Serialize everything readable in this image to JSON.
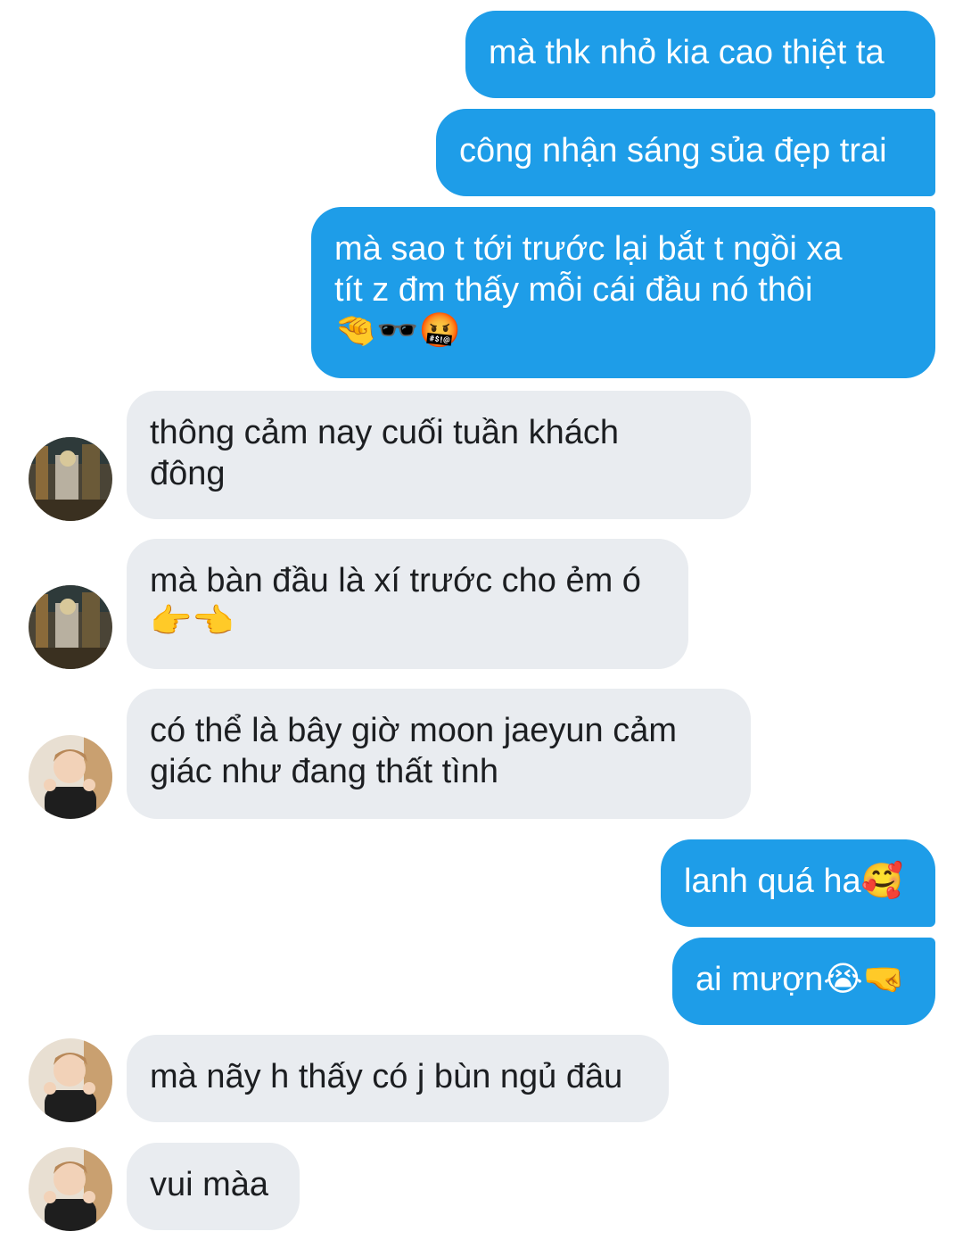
{
  "messages": [
    {
      "side": "out",
      "text": "mà thk nhỏ kia cao thiệt ta"
    },
    {
      "side": "out",
      "text": "công nhận sáng sủa đẹp trai"
    },
    {
      "side": "out",
      "text": "mà sao t tới trước lại bắt t ngồi xa\ntít z đm thấy mỗi cái đầu nó thôi\n🤏🕶️🤬"
    },
    {
      "side": "in",
      "avatar": "avatar-street",
      "text": "thông cảm nay cuối tuần khách\nđông"
    },
    {
      "side": "in",
      "avatar": "avatar-street",
      "text": "mà bàn đầu là xí trước cho ẻm ó\n👉👈"
    },
    {
      "side": "in",
      "avatar": "avatar-person",
      "text": "có thể là bây giờ moon jaeyun cảm\ngiác như đang thất tình"
    },
    {
      "side": "out",
      "text": "lanh quá ha🥰"
    },
    {
      "side": "out",
      "text": "ai mượn😭🤜"
    },
    {
      "side": "in",
      "avatar": "avatar-person",
      "text": "mà nãy h thấy có j bùn ngủ đâu"
    },
    {
      "side": "in",
      "avatar": "avatar-person",
      "text": "vui màa"
    }
  ],
  "colors": {
    "outgoing_bubble": "#1e9de8",
    "incoming_bubble": "#e9ecf0",
    "background": "#ffffff"
  }
}
